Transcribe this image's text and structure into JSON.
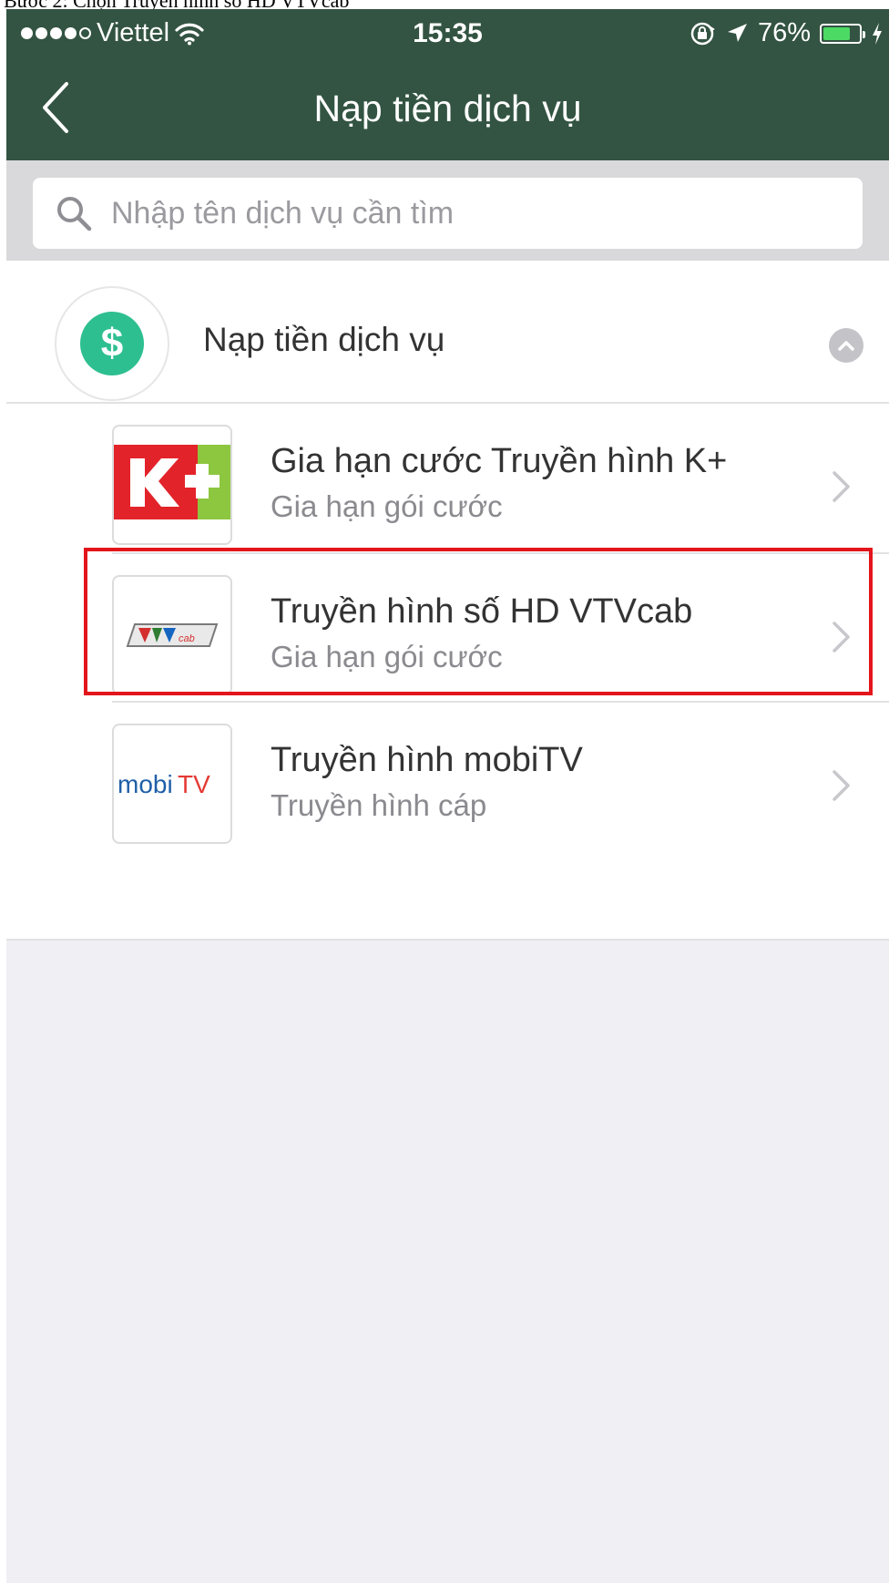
{
  "caption": "Bước 2: Chọn Truyền hình số HD VTVcab",
  "status_bar": {
    "carrier": "Viettel",
    "time": "15:35",
    "battery_percent": "76%",
    "battery_level": 0.76,
    "signal_bars": 4,
    "icons": [
      "wifi-icon",
      "rotation-lock-icon",
      "location-icon",
      "charging-icon"
    ]
  },
  "nav": {
    "title": "Nạp tiền dịch vụ",
    "back_icon": "chevron-left-icon"
  },
  "search": {
    "placeholder": "Nhập tên dịch vụ cần tìm",
    "value": ""
  },
  "category": {
    "label": "Nạp tiền dịch vụ",
    "icon": "dollar-icon",
    "toggle_icon": "chevron-up-icon"
  },
  "services": [
    {
      "title": "Gia hạn cước Truyền hình K+",
      "subtitle": "Gia hạn gói cước",
      "logo_text": "K+"
    },
    {
      "title": "Truyền hình số HD VTVcab",
      "subtitle": "Gia hạn gói cước",
      "logo_text": "VTVcab"
    },
    {
      "title": "Truyền hình mobiTV",
      "subtitle": "Truyền hình cáp",
      "logo_text": "mobiTV"
    }
  ],
  "colors": {
    "header": "#335442",
    "accent_green": "#2ebf91",
    "highlight": "#e3151b",
    "battery": "#4cd964"
  }
}
